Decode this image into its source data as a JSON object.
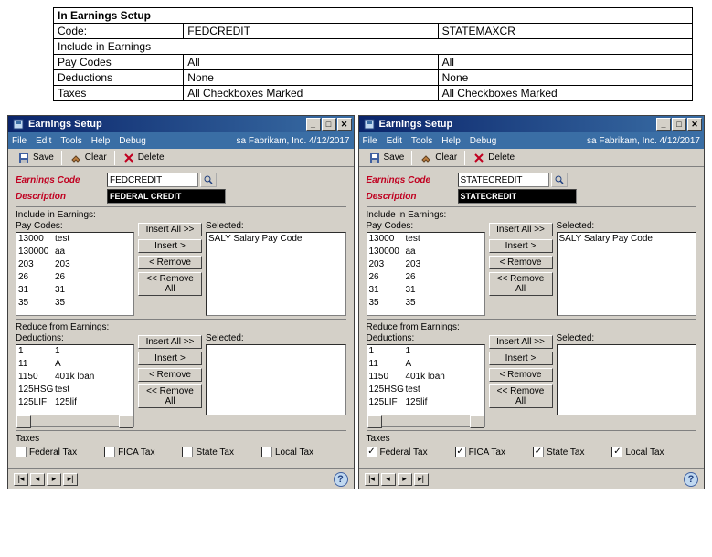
{
  "summary_table": {
    "title": "In Earnings Setup",
    "cols": [
      "Code:",
      "FEDCREDIT",
      "STATEMAXCR"
    ],
    "section": "Include in Earnings",
    "rows": [
      [
        "Pay Codes",
        "All",
        "All"
      ],
      [
        "Deductions",
        "None",
        "None"
      ],
      [
        "Taxes",
        "All Checkboxes Marked",
        "All Checkboxes Marked"
      ]
    ]
  },
  "menu": {
    "items": [
      "File",
      "Edit",
      "Tools",
      "Help",
      "Debug"
    ],
    "right": "sa  Fabrikam, Inc.  4/12/2017"
  },
  "toolbar": {
    "save": "Save",
    "clear": "Clear",
    "delete": "Delete"
  },
  "labels": {
    "win_title": "Earnings Setup",
    "earnings_code": "Earnings Code",
    "description": "Description",
    "include": "Include in Earnings:",
    "paycodes": "Pay Codes:",
    "selected": "Selected:",
    "reduce": "Reduce from Earnings:",
    "deductions": "Deductions:",
    "taxes": "Taxes",
    "insert_all": "Insert All >>",
    "insert": "Insert >",
    "remove": "< Remove",
    "remove_all": "<< Remove All",
    "fed": "Federal Tax",
    "fica": "FICA Tax",
    "state": "State Tax",
    "local": "Local Tax"
  },
  "paycode_list": [
    {
      "code": "13000",
      "desc": "test"
    },
    {
      "code": "130000",
      "desc": "aa"
    },
    {
      "code": "203",
      "desc": "203"
    },
    {
      "code": "26",
      "desc": "26"
    },
    {
      "code": "31",
      "desc": "31"
    },
    {
      "code": "35",
      "desc": "35"
    }
  ],
  "selected_paycode": "SALY   Salary Pay Code",
  "deduction_list": [
    {
      "code": "1",
      "desc": "1"
    },
    {
      "code": "11",
      "desc": "A"
    },
    {
      "code": "1150",
      "desc": "401k loan"
    },
    {
      "code": "125HSG",
      "desc": "test"
    },
    {
      "code": "125LIF",
      "desc": "125lif"
    }
  ],
  "win1": {
    "code": "FEDCREDIT",
    "desc": "FEDERAL CREDIT",
    "taxes_checked": false
  },
  "win2": {
    "code": "STATECREDIT",
    "desc": "STATECREDIT",
    "taxes_checked": true
  }
}
